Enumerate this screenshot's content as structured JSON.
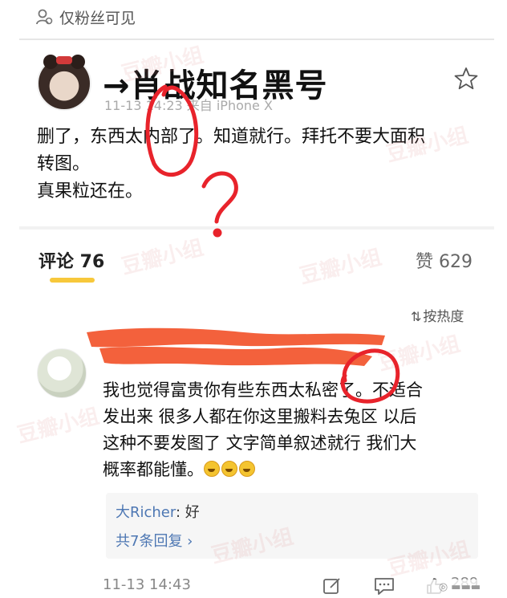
{
  "visibility": {
    "label": "仅粉丝可见",
    "icon": "fans-only-icon"
  },
  "post": {
    "author_annotation": "→肖战知名黑号",
    "meta": "11-13 14:23 来自 iPhone X",
    "body_lines": [
      "删了，东西太内部了。知道就行。拜托不要大面积",
      "转图。",
      "真果粒还在。"
    ]
  },
  "comments_tab": {
    "label": "评论 76"
  },
  "likes": {
    "label": "赞 629"
  },
  "sort": {
    "label": "按热度",
    "icon": "sort-icon"
  },
  "comment": {
    "text_lines": [
      "我也觉得富贵你有些东西太私密了。不适合",
      "发出来 很多人都在你这里搬料去兔区 以后",
      "这种不要发图了 文字简单叙述就行 我们大",
      "概率都能懂。"
    ],
    "reply_author": "大Richer",
    "reply_text": ": 好",
    "more_replies": "共7条回复 ›",
    "time": "11-13 14:43",
    "like_count": "289"
  },
  "watermark": "豆瓣小组",
  "colors": {
    "annotation_red": "#e8232b",
    "scribble_orange": "#f2542b",
    "tab_underline": "#f7c83b",
    "link_blue": "#4d77b3"
  }
}
